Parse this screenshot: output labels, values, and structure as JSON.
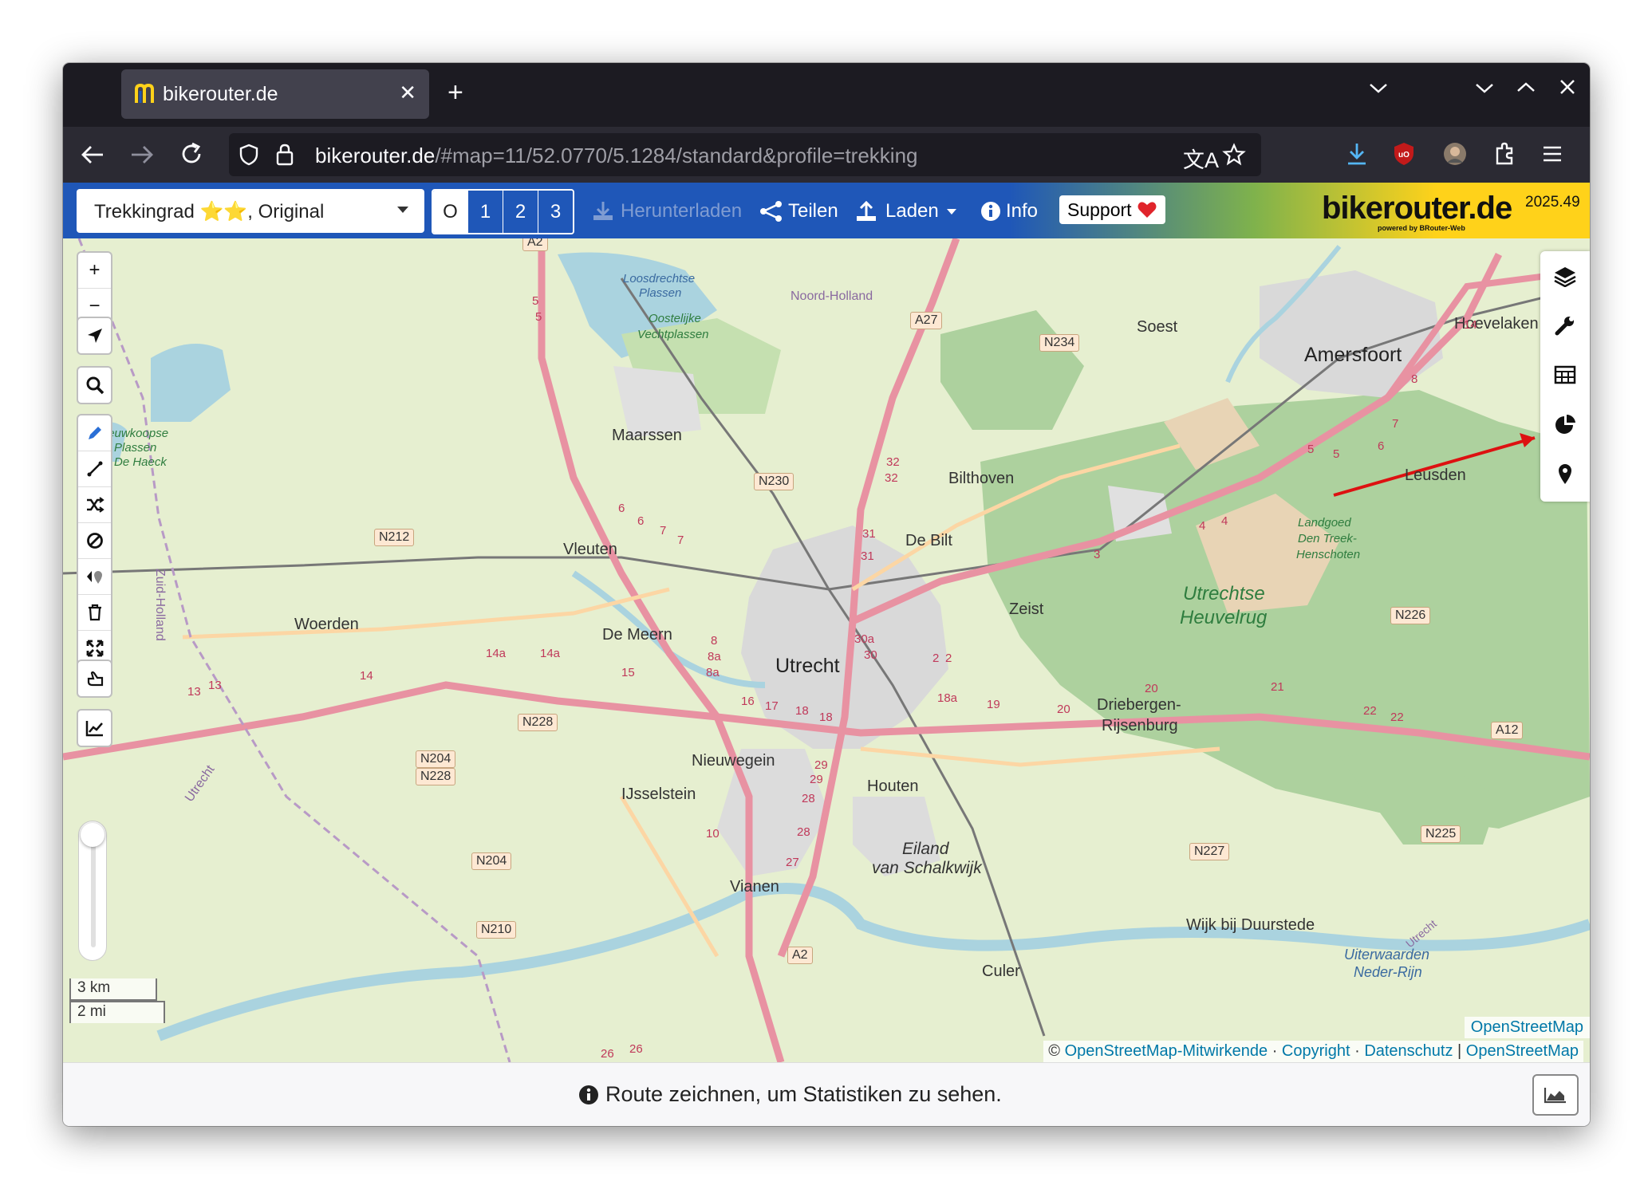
{
  "browser": {
    "tab_title": "bikerouter.de",
    "url_host": "bikerouter.de",
    "url_path": "/#map=11/52.0770/5.1284/standard&profile=trekking"
  },
  "toolbar": {
    "profile_label": "Trekkingrad ⭐⭐, Original",
    "alternatives": [
      "O",
      "1",
      "2",
      "3"
    ],
    "download_label": "Herunterladen",
    "share_label": "Teilen",
    "load_label": "Laden",
    "info_label": "Info",
    "support_label": "Support",
    "brand": "bikerouter.de",
    "brand_sub": "powered by BRouter-Web",
    "version": "2025.49",
    "accent_color": "#1f57b8",
    "brand_color": "#ffd21a"
  },
  "map": {
    "cities": {
      "utrecht": "Utrecht",
      "amersfoort": "Amersfoort",
      "maarssen": "Maarssen",
      "soest": "Soest",
      "bilthoven": "Bilthoven",
      "debilt": "De Bilt",
      "vleuten": "Vleuten",
      "demeern": "De Meern",
      "woerden": "Woerden",
      "zeist": "Zeist",
      "leusden": "Leusden",
      "hoevelaken": "Hoevelaken",
      "driebergen1": "Driebergen-",
      "driebergen2": "Rijsenburg",
      "nieuwegein": "Nieuwegein",
      "ijsselstein": "IJsselstein",
      "houten": "Houten",
      "vianen": "Vianen",
      "wijk": "Wijk bij Duurstede",
      "culemborg": "Culer"
    },
    "areas": {
      "heuvelrug1": "Utrechtse",
      "heuvelrug2": "Heuvelrug",
      "eiland1": "Eiland",
      "eiland2": "van Schalkwijk",
      "landgoed1": "Landgoed",
      "landgoed2": "Den Treek-",
      "landgoed3": "Henschoten",
      "uiterwaarden1": "Uiterwaarden",
      "uiterwaarden2": "Neder-Rijn",
      "loosdrecht1": "Loosdrechtse",
      "loosdrecht2": "Plassen",
      "vecht1": "Oostelijke",
      "vecht2": "Vechtplassen",
      "nieuwkoop1": "Nieuwkoopse",
      "nieuwkoop2": "Plassen",
      "nieuwkoop3": "De Haeck",
      "noordholland": "Noord-Holland",
      "zuidholland": "Zuid-Holland",
      "utrecht_prov": "Utrecht",
      "utrecht_prov2": "Utrecht"
    },
    "roads": [
      "A2",
      "A27",
      "N234",
      "N230",
      "N212",
      "N228",
      "N204",
      "N228",
      "N204",
      "N210",
      "A2",
      "N226",
      "A12",
      "N225",
      "N227"
    ],
    "road_numbers": [
      "13",
      "13",
      "14",
      "14a",
      "14a",
      "15",
      "16",
      "17",
      "18",
      "18",
      "18a",
      "19",
      "20",
      "20",
      "21",
      "22",
      "22",
      "8",
      "8a",
      "8a",
      "5",
      "5",
      "6",
      "6",
      "7",
      "7",
      "27",
      "28",
      "28",
      "29",
      "29",
      "10",
      "26",
      "26",
      "30a",
      "30",
      "2",
      "2",
      "31",
      "31",
      "32",
      "32",
      "3",
      "4",
      "4",
      "5",
      "5",
      "6",
      "7",
      "8",
      "14"
    ],
    "scale_km": "3 km",
    "scale_mi": "2 mi",
    "attribution_prefix": "©",
    "attribution_osm": "OpenStreetMap-Mitwirkende",
    "attribution_copyright": "Copyright",
    "attribution_privacy": "Datenschutz",
    "attribution_layer": "OpenStreetMap",
    "layer_label": "OpenStreetMap",
    "zoom_in": "+",
    "zoom_out": "−"
  },
  "footer": {
    "message": "Route zeichnen, um Statistiken zu sehen."
  }
}
